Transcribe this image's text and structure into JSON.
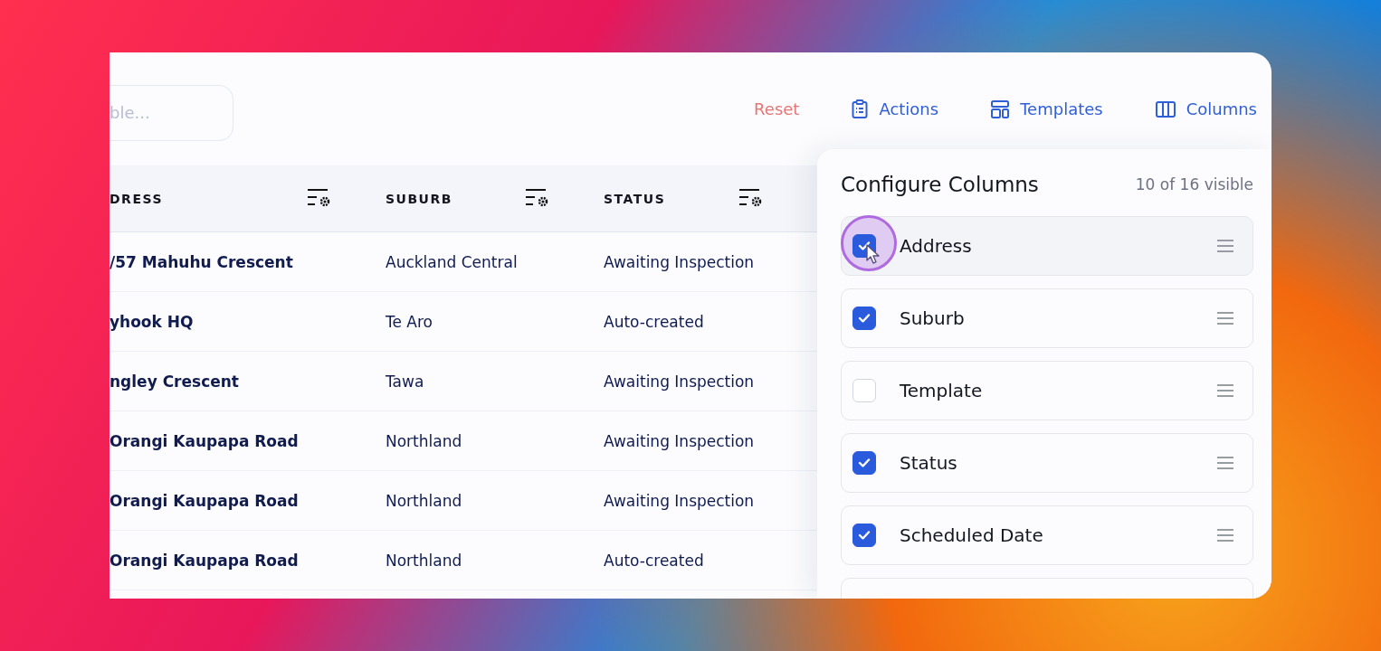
{
  "search": {
    "placeholder": "ble..."
  },
  "toolbar": {
    "reset": "Reset",
    "actions": "Actions",
    "templates": "Templates",
    "columns": "Columns"
  },
  "table": {
    "columns": [
      "DRESS",
      "SUBURB",
      "STATUS"
    ],
    "rows": [
      {
        "address": "/57 Mahuhu Crescent",
        "suburb": "Auckland Central",
        "status": "Awaiting Inspection"
      },
      {
        "address": "yhook HQ",
        "suburb": "Te Aro",
        "status": "Auto-created"
      },
      {
        "address": "ngley Crescent",
        "suburb": "Tawa",
        "status": "Awaiting Inspection"
      },
      {
        "address": "Orangi Kaupapa Road",
        "suburb": "Northland",
        "status": "Awaiting Inspection"
      },
      {
        "address": "Orangi Kaupapa Road",
        "suburb": "Northland",
        "status": "Awaiting Inspection"
      },
      {
        "address": "Orangi Kaupapa Road",
        "suburb": "Northland",
        "status": "Auto-created"
      }
    ]
  },
  "column_panel": {
    "title": "Configure Columns",
    "count": "10 of 16 visible",
    "items": [
      {
        "label": "Address",
        "checked": true,
        "hovered": true
      },
      {
        "label": "Suburb",
        "checked": true,
        "hovered": false
      },
      {
        "label": "Template",
        "checked": false,
        "hovered": false
      },
      {
        "label": "Status",
        "checked": true,
        "hovered": false
      },
      {
        "label": "Scheduled Date",
        "checked": true,
        "hovered": false
      }
    ]
  }
}
